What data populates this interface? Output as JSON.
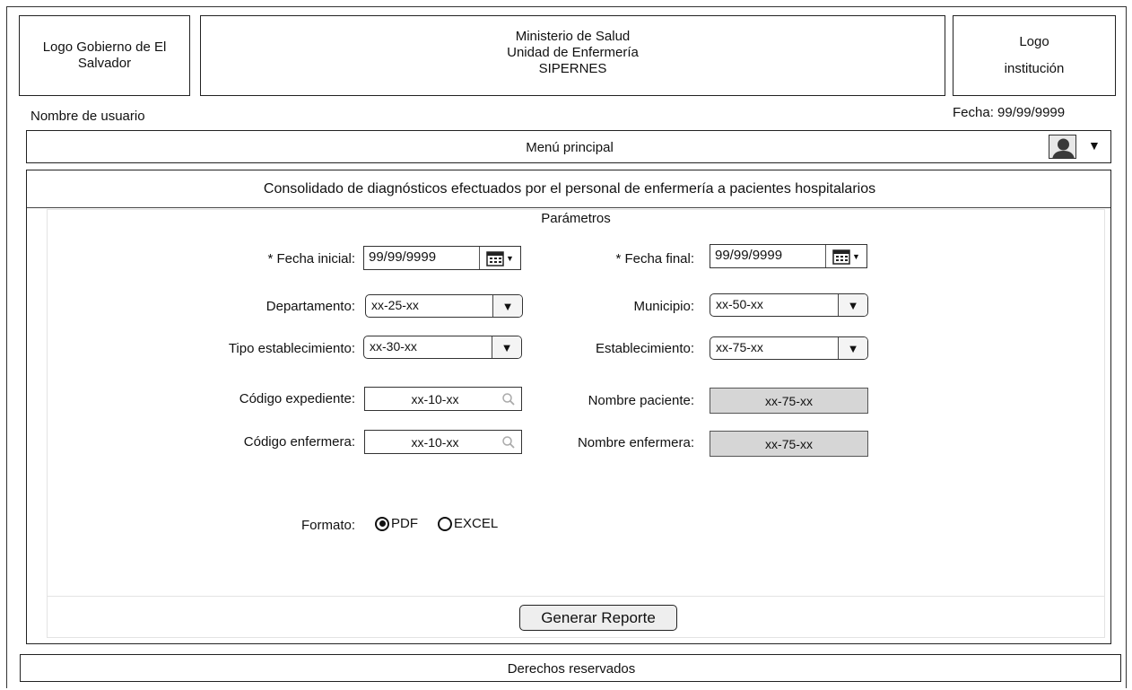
{
  "header": {
    "logo_left": "Logo Gobierno de El Salvador",
    "title_line1": "Ministerio de Salud",
    "title_line2": "Unidad de Enfermería",
    "title_line3": "SIPERNES",
    "logo_right_line1": "Logo",
    "logo_right_line2": "institución"
  },
  "user_name": "Nombre de usuario",
  "date_label": "Fecha: 99/99/9999",
  "menu": {
    "label": "Menú principal"
  },
  "report": {
    "title": "Consolidado de diagnósticos efectuados por el personal de enfermería a pacientes hospitalarios",
    "params_title": "Parámetros",
    "fecha_inicial_label": "* Fecha inicial:",
    "fecha_inicial_value": "99/99/9999",
    "fecha_final_label": "* Fecha final:",
    "fecha_final_value": "99/99/9999",
    "departamento_label": "Departamento:",
    "departamento_value": "xx-25-xx",
    "municipio_label": "Municipio:",
    "municipio_value": "xx-50-xx",
    "tipo_label": "Tipo establecimiento:",
    "tipo_value": "xx-30-xx",
    "establecimiento_label": "Establecimiento:",
    "establecimiento_value": "xx-75-xx",
    "codigo_exp_label": "Código expediente:",
    "codigo_exp_value": "xx-10-xx",
    "nombre_paciente_label": "Nombre paciente:",
    "nombre_paciente_value": "xx-75-xx",
    "codigo_enf_label": "Código enfermera:",
    "codigo_enf_value": "xx-10-xx",
    "nombre_enf_label": "Nombre enfermera:",
    "nombre_enf_value": "xx-75-xx",
    "formato_label": "Formato:",
    "formato_options": [
      "PDF",
      "EXCEL"
    ],
    "formato_selected": "PDF",
    "generate_label": "Generar Reporte"
  },
  "footer": {
    "label": "Derechos reservados"
  },
  "icons": {
    "user": "user-avatar-icon",
    "dropdown": "caret-down-icon",
    "calendar": "calendar-icon",
    "search": "magnifier-icon"
  }
}
